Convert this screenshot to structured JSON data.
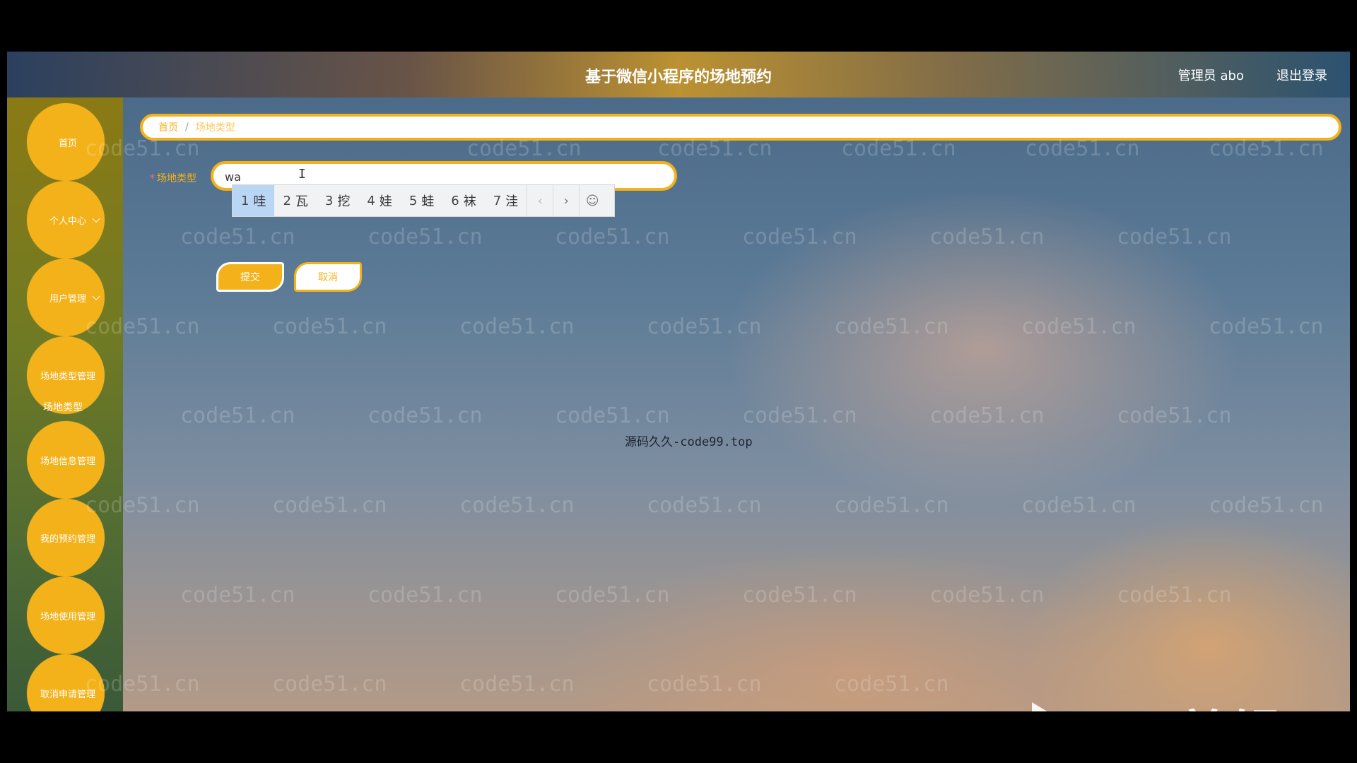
{
  "app": {
    "title": "基于微信小程序的场地预约",
    "user": "管理员 abo",
    "logout": "退出登录"
  },
  "sidebar": {
    "items": [
      {
        "label": "首页"
      },
      {
        "label": "个人中心"
      },
      {
        "label": "用户管理"
      },
      {
        "label": "场地类型管理"
      },
      {
        "label": "场地信息管理"
      },
      {
        "label": "我的预约管理"
      },
      {
        "label": "场地使用管理"
      },
      {
        "label": "取消申请管理"
      }
    ],
    "submenu_label": "场地类型"
  },
  "breadcrumb": {
    "home": "首页",
    "separator": "/",
    "current": "场地类型"
  },
  "form": {
    "required_mark": "*",
    "field_label": "场地类型",
    "field_value": "wa",
    "submit_label": "提交",
    "cancel_label": "取消"
  },
  "ime": {
    "candidates": [
      {
        "num": "1",
        "char": "哇"
      },
      {
        "num": "2",
        "char": "瓦"
      },
      {
        "num": "3",
        "char": "挖"
      },
      {
        "num": "4",
        "char": "娃"
      },
      {
        "num": "5",
        "char": "蛙"
      },
      {
        "num": "6",
        "char": "袜"
      },
      {
        "num": "7",
        "char": "洼"
      }
    ],
    "prev": "‹",
    "next": "›",
    "emoji": "☺"
  },
  "overlay": {
    "center_text": "源码久久-code99.top",
    "watermark": "code51.cn",
    "ev_logo": "eV剪辑"
  },
  "colors": {
    "accent": "#f4b21a",
    "sidebar": "#7a7a1e"
  }
}
